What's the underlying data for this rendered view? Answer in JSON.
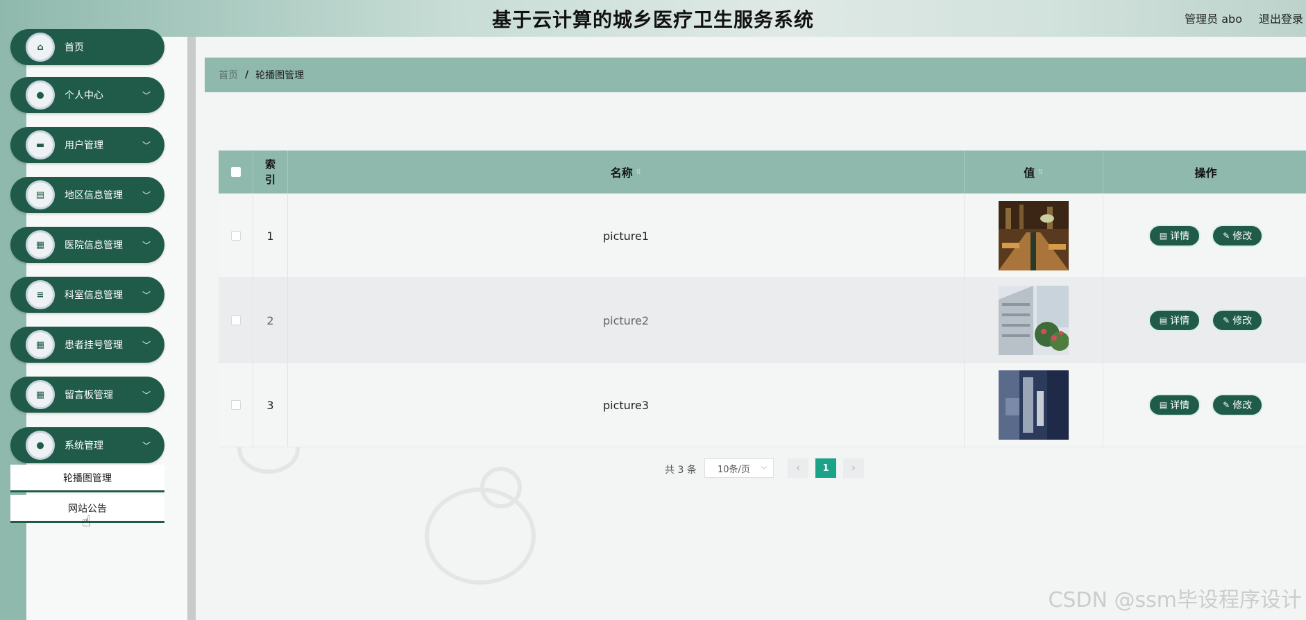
{
  "header": {
    "title": "基于云计算的城乡医疗卫生服务系统",
    "user": "管理员 abo",
    "logout": "退出登录"
  },
  "sidebar": {
    "items": [
      {
        "label": "首页",
        "icon": "home-icon",
        "glyph": "⌂",
        "chevron": false
      },
      {
        "label": "个人中心",
        "icon": "user-icon",
        "glyph": "●",
        "chevron": true
      },
      {
        "label": "用户管理",
        "icon": "briefcase-icon",
        "glyph": "▬",
        "chevron": true
      },
      {
        "label": "地区信息管理",
        "icon": "clipboard-icon",
        "glyph": "▤",
        "chevron": true
      },
      {
        "label": "医院信息管理",
        "icon": "grid-icon",
        "glyph": "▦",
        "chevron": true
      },
      {
        "label": "科室信息管理",
        "icon": "list-icon",
        "glyph": "≡",
        "chevron": true
      },
      {
        "label": "患者挂号管理",
        "icon": "grid-icon",
        "glyph": "▦",
        "chevron": true
      },
      {
        "label": "留言板管理",
        "icon": "grid-icon",
        "glyph": "▦",
        "chevron": true
      },
      {
        "label": "系统管理",
        "icon": "user-settings-icon",
        "glyph": "●",
        "chevron": true
      }
    ],
    "sub_items": [
      {
        "label": "轮播图管理"
      },
      {
        "label": "网站公告"
      }
    ]
  },
  "breadcrumb": {
    "home": "首页",
    "separator": "/",
    "current": "轮播图管理"
  },
  "table": {
    "columns": [
      "索引",
      "名称",
      "值",
      "操作"
    ],
    "rows": [
      {
        "index": "1",
        "name": "picture1",
        "image": "library-interior"
      },
      {
        "index": "2",
        "name": "picture2",
        "image": "building-exterior"
      },
      {
        "index": "3",
        "name": "picture3",
        "image": "blurred-abstract"
      }
    ],
    "actions": {
      "detail": "详情",
      "edit": "修改"
    }
  },
  "pagination": {
    "total": "共 3 条",
    "page_size": "10条/页",
    "current_page": "1",
    "prev": "‹",
    "next": "›"
  },
  "watermark": "CSDN @ssm毕设程序设计",
  "colors": {
    "accent": "#1f5b48",
    "header_bg": "#8fb9ad",
    "page_active": "#1aa389"
  }
}
